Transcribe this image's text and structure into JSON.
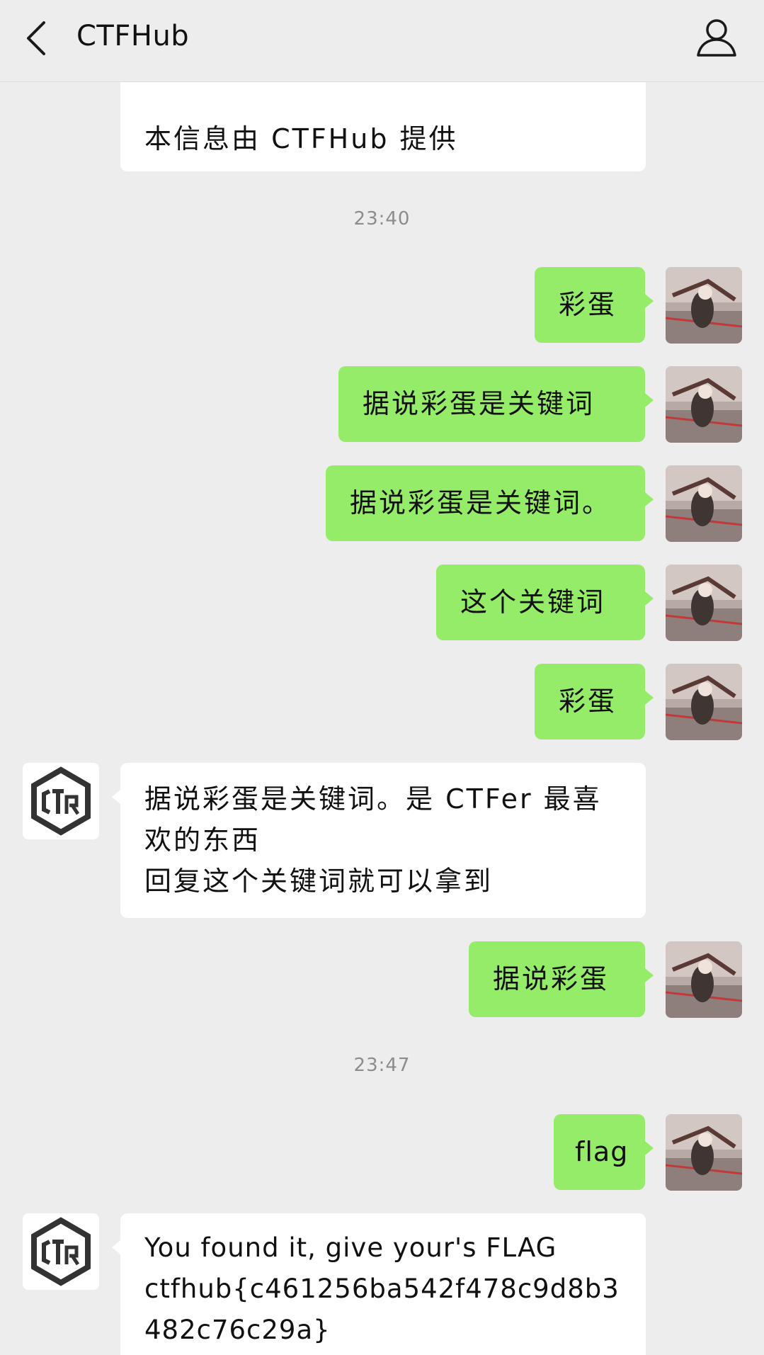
{
  "header": {
    "title": "CTFHub",
    "back_icon": "chevron-left-icon",
    "profile_icon": "person-icon"
  },
  "colors": {
    "background": "#ededed",
    "outgoing_bubble": "#95ec69",
    "incoming_bubble": "#ffffff",
    "timestamp": "#8c8c8c"
  },
  "messages": [
    {
      "side": "in",
      "text": "本信息由 CTFHub 提供"
    },
    {
      "type": "time",
      "text": "23:40"
    },
    {
      "side": "out",
      "text": "彩蛋"
    },
    {
      "side": "out",
      "text": "据说彩蛋是关键词"
    },
    {
      "side": "out",
      "text": "据说彩蛋是关键词。"
    },
    {
      "side": "out",
      "text": "这个关键词"
    },
    {
      "side": "out",
      "text": "彩蛋"
    },
    {
      "side": "in",
      "text": "据说彩蛋是关键词。是 CTFer 最喜欢的东西\n回复这个关键词就可以拿到"
    },
    {
      "side": "out",
      "text": "据说彩蛋"
    },
    {
      "type": "time",
      "text": "23:47"
    },
    {
      "side": "out",
      "text": "flag"
    },
    {
      "side": "in",
      "text": "You found it, give your's FLAG\nctfhub{c461256ba542f478c9d8b3482c76c29a}"
    }
  ]
}
